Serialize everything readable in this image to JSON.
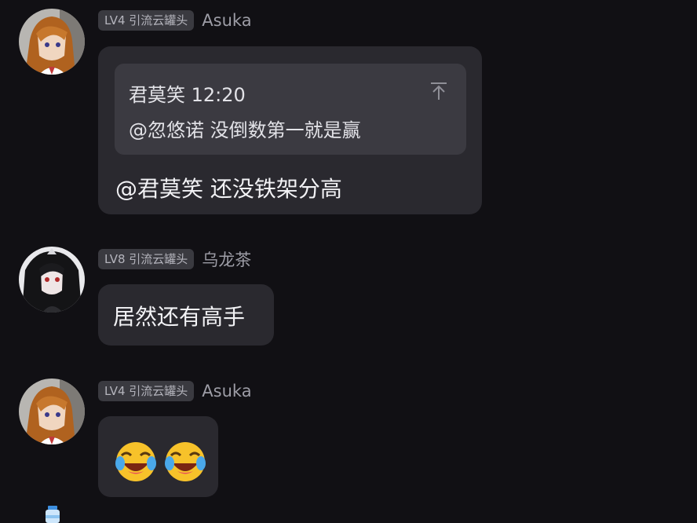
{
  "messages": [
    {
      "badge": "LV4 引流云罐头",
      "username": "Asuka",
      "avatar_icon": "asuka-avatar",
      "quote": {
        "line1": "君莫笑 12:20",
        "line2": "@忽悠诺 没倒数第一就是赢",
        "icon": "jump-to-top-icon"
      },
      "text": "@君莫笑 还没铁架分高"
    },
    {
      "badge": "LV8 引流云罐头",
      "username": "乌龙茶",
      "avatar_icon": "dark-hair-girl-avatar",
      "text": "居然还有高手"
    },
    {
      "badge": "LV4 引流云罐头",
      "username": "Asuka",
      "avatar_icon": "asuka-avatar",
      "emojis": [
        "laughing-crying-emoji",
        "laughing-crying-emoji"
      ]
    }
  ],
  "colors": {
    "background": "#111014",
    "bubble": "#2a292f",
    "quote": "#3b3a41",
    "badge": "#3a3a40",
    "username": "#9d9da6"
  }
}
